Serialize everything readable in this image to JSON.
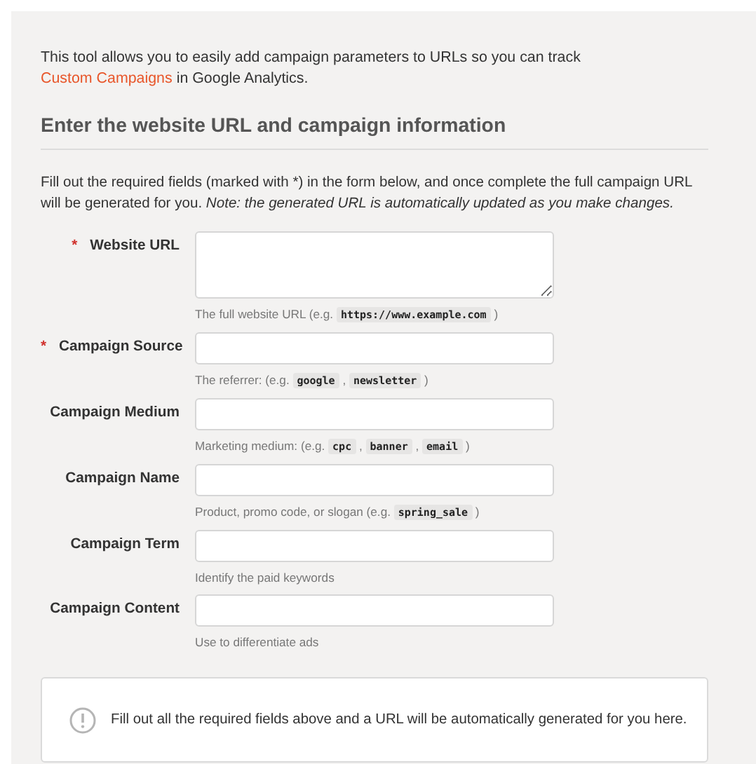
{
  "intro": {
    "before": "This tool allows you to easily add campaign parameters to URLs so you can track ",
    "link": "Custom Campaigns",
    "after": " in Google Analytics."
  },
  "heading": "Enter the website URL and campaign information",
  "instructions": "Fill out the required fields (marked with *) in the form below, and once complete the full campaign URL will be generated for you. *Note: the generated URL is automatically updated as you make changes.*",
  "fields": [
    {
      "label": "Website URL",
      "required": true,
      "kind": "textarea",
      "hint": [
        {
          "kind": "text",
          "text": "The full website URL (e.g. "
        },
        {
          "kind": "code",
          "text": "https://www.example.com"
        },
        {
          "kind": "text",
          "text": " )"
        }
      ]
    },
    {
      "label": "Campaign Source",
      "required": true,
      "kind": "input",
      "hint": [
        {
          "kind": "text",
          "text": "The referrer: (e.g. "
        },
        {
          "kind": "code",
          "text": "google"
        },
        {
          "kind": "text",
          "text": " , "
        },
        {
          "kind": "code",
          "text": "newsletter"
        },
        {
          "kind": "text",
          "text": " )"
        }
      ]
    },
    {
      "label": "Campaign Medium",
      "required": false,
      "kind": "input",
      "hint": [
        {
          "kind": "text",
          "text": "Marketing medium: (e.g. "
        },
        {
          "kind": "code",
          "text": "cpc"
        },
        {
          "kind": "text",
          "text": " , "
        },
        {
          "kind": "code",
          "text": "banner"
        },
        {
          "kind": "text",
          "text": " , "
        },
        {
          "kind": "code",
          "text": "email"
        },
        {
          "kind": "text",
          "text": " )"
        }
      ]
    },
    {
      "label": "Campaign Name",
      "required": false,
      "kind": "input",
      "hint": [
        {
          "kind": "text",
          "text": "Product, promo code, or slogan (e.g. "
        },
        {
          "kind": "code",
          "text": "spring_sale"
        },
        {
          "kind": "text",
          "text": " )"
        }
      ]
    },
    {
      "label": "Campaign Term",
      "required": false,
      "kind": "input",
      "hint": [
        {
          "kind": "text",
          "text": "Identify the paid keywords"
        }
      ]
    },
    {
      "label": "Campaign Content",
      "required": false,
      "kind": "input",
      "hint": [
        {
          "kind": "text",
          "text": "Use to differentiate ads"
        }
      ]
    }
  ],
  "required_mark": "*",
  "notice": "Fill out all the required fields above and a URL will be automatically generated for you here."
}
